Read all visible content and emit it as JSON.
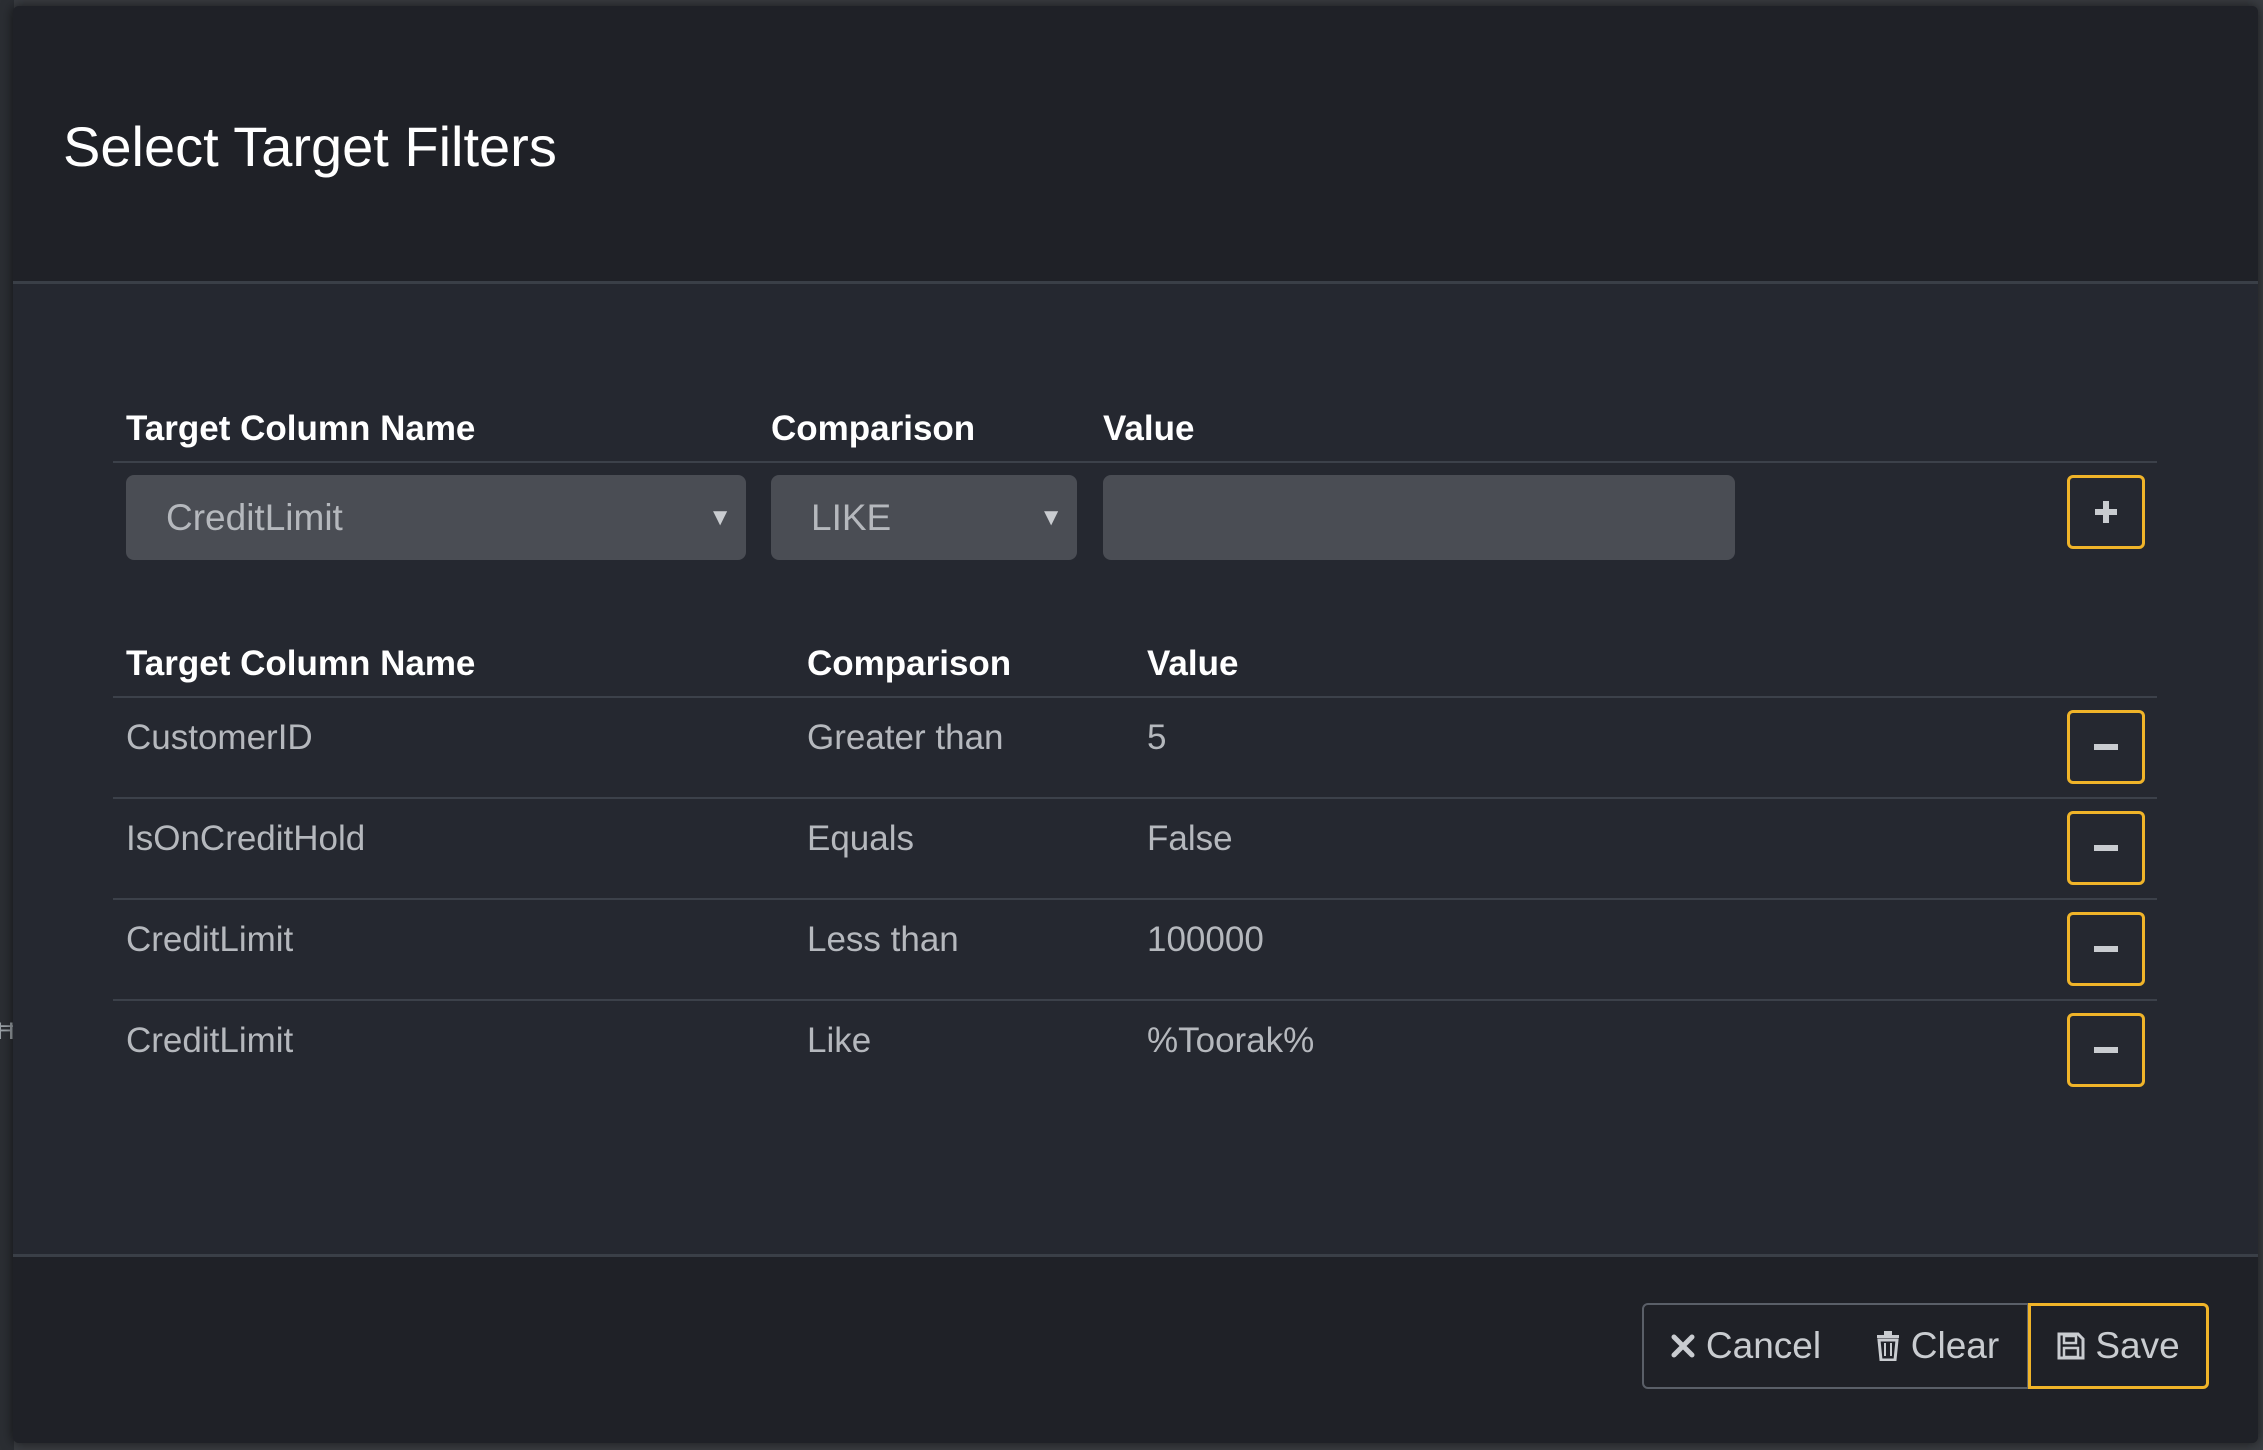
{
  "dialog": {
    "title": "Select Target Filters"
  },
  "new_filter": {
    "headers": {
      "column": "Target Column Name",
      "comparison": "Comparison",
      "value": "Value"
    },
    "column_selected": "CreditLimit",
    "comparison_selected": "LIKE",
    "value_input": "",
    "add_icon": "plus-icon"
  },
  "filters_table": {
    "headers": {
      "column": "Target Column Name",
      "comparison": "Comparison",
      "value": "Value"
    },
    "rows": [
      {
        "column": "CustomerID",
        "comparison": "Greater than",
        "value": "5"
      },
      {
        "column": "IsOnCreditHold",
        "comparison": "Equals",
        "value": "False"
      },
      {
        "column": "CreditLimit",
        "comparison": "Less than",
        "value": "100000"
      },
      {
        "column": "CreditLimit",
        "comparison": "Like",
        "value": "%Toorak%"
      }
    ],
    "remove_icon": "minus-icon"
  },
  "footer": {
    "cancel_label": "Cancel",
    "clear_label": "Clear",
    "save_label": "Save",
    "cancel_icon": "x-icon",
    "clear_icon": "trash-icon",
    "save_icon": "floppy-disk-icon"
  },
  "colors": {
    "accent": "#f0b429",
    "header_bg": "#1f2127",
    "body_bg": "#252830",
    "input_bg": "#4a4d54"
  }
}
